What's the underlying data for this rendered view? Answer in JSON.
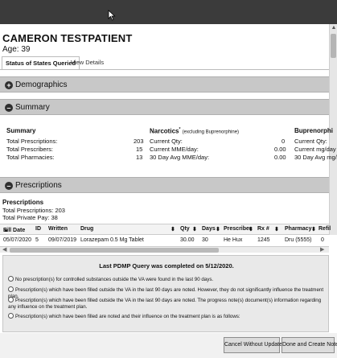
{
  "patient": {
    "name": "CAMERON TESTPATIENT",
    "age": "Age: 39"
  },
  "tabs": [
    {
      "label": "Status of States Queried"
    },
    {
      "label": "View Details"
    }
  ],
  "sections": {
    "demographics": {
      "label": "Demographics",
      "toggle": "+"
    },
    "summary": {
      "label": "Summary",
      "toggle": "–"
    },
    "prescriptions": {
      "label": "Prescriptions",
      "toggle": "–"
    }
  },
  "summary": {
    "col1": {
      "heading": "Summary",
      "rows": [
        {
          "label": "Total Prescriptions:",
          "value": "203"
        },
        {
          "label": "Total Prescribers:",
          "value": "15"
        },
        {
          "label": "Total Pharmacies:",
          "value": "13"
        }
      ]
    },
    "col2": {
      "heading": "Narcotics",
      "sup": "*",
      "note": "(excluding Buprenorphine)",
      "rows": [
        {
          "label": "Current Qty:",
          "value": "0"
        },
        {
          "label": "Current MME/day:",
          "value": "0.00"
        },
        {
          "label": "30 Day Avg MME/day:",
          "value": "0.00"
        }
      ]
    },
    "col3": {
      "heading": "Buprenorphi",
      "rows": [
        {
          "label": "Current Qty:"
        },
        {
          "label": "Current mg/day"
        },
        {
          "label": "30 Day Avg mg/"
        }
      ]
    }
  },
  "prescriptions": {
    "heading": "Prescriptions",
    "total_prescriptions": "Total Prescriptions: 203",
    "total_private_pay": "Total Private Pay:  38",
    "columns": [
      "Fill Date",
      "ID",
      "Written",
      "Drug",
      "Qty",
      "Days",
      "Prescriber",
      "Rx #",
      "Pharmacy",
      "Refil"
    ],
    "rows": [
      [
        "05/07/2020",
        "5",
        "09/07/2019",
        "Lorazepam 0.5 Mg Tablet",
        "30.00",
        "30",
        "He Hux",
        "1245",
        "Dru (5555)",
        "0"
      ]
    ]
  },
  "pdmp": {
    "title": "Last PDMP Query was completed on 5/12/2020.",
    "options": [
      "No prescription(s) for controlled substances outside the VA were found in the last 90 days.",
      "Prescription(s) which have been filled outside the VA in the last 90 days are noted. However, they do not significantly influence the treatment plan.",
      "Prescription(s) which have been filled outside the VA in the last 90 days are noted. The progress note(s) document(s) information regarding any influence on the treatment plan.",
      "Prescription(s) which have been filled are noted and their influence on the treatment plan is as follows:"
    ]
  },
  "buttons": {
    "cancel": "Cancel Without Update",
    "done": "Done and Create Note"
  }
}
